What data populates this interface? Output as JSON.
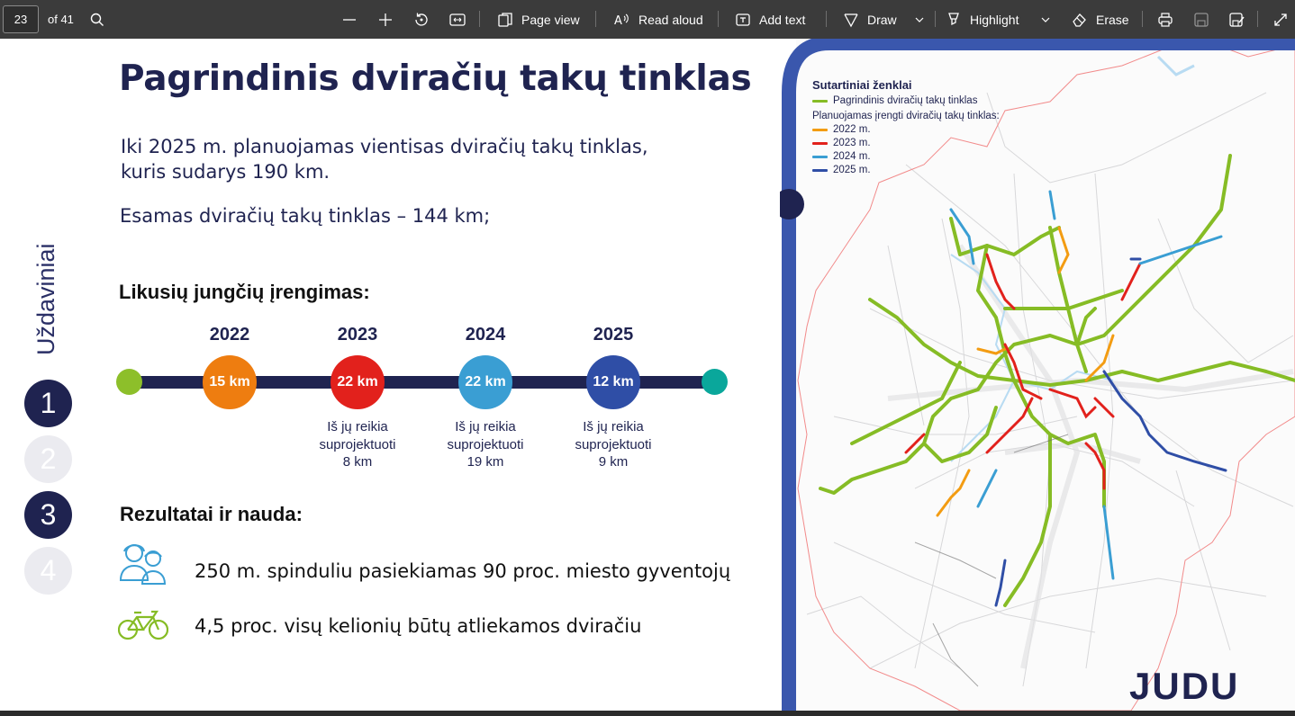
{
  "toolbar": {
    "page_number": "23",
    "page_total": "of 41",
    "page_view": "Page view",
    "read_aloud": "Read aloud",
    "add_text": "Add text",
    "draw": "Draw",
    "highlight": "Highlight",
    "erase": "Erase"
  },
  "slide": {
    "title": "Pagrindinis dviračių takų tinklas",
    "intro_line1": "Iki 2025 m. planuojamas vientisas dviračių takų tinklas,",
    "intro_line2": "kuris sudarys 190 km.",
    "existing": "Esamas dviračių takų tinklas – 144 km;",
    "section_label": "Uždaviniai",
    "steps": [
      "1",
      "2",
      "3",
      "4"
    ],
    "remaining_heading": "Likusių jungčių įrengimas:",
    "timeline": [
      {
        "year": "2022",
        "km": "15 km",
        "color": "#ee7d10",
        "note": []
      },
      {
        "year": "2023",
        "km": "22 km",
        "color": "#e2211c",
        "note": [
          "Iš jų reikia",
          "suprojektuoti",
          "8 km"
        ]
      },
      {
        "year": "2024",
        "km": "22 km",
        "color": "#3a9ed3",
        "note": [
          "Iš jų reikia",
          "suprojektuoti",
          "19 km"
        ]
      },
      {
        "year": "2025",
        "km": "12 km",
        "color": "#2f4ea6",
        "note": [
          "Iš jų reikia",
          "suprojektuoti",
          "9 km"
        ]
      }
    ],
    "timeline_start_color": "#8dbf2a",
    "timeline_end_color": "#0aa79b",
    "results_heading": "Rezultatai ir nauda:",
    "benefit1": "250 m. spinduliu pasiekiamas 90 proc. miesto gyventojų",
    "benefit2": "4,5 proc. visų kelionių būtų atliekamos dviračiu"
  },
  "legend": {
    "title": "Sutartiniai ženklai",
    "main": "Pagrindinis dviračių takų tinklas",
    "main_color": "#86bc25",
    "planned": "Planuojamas įrengti dviračių takų tinklas:",
    "items": [
      {
        "label": "2022 m.",
        "color": "#f39c12"
      },
      {
        "label": "2023 m.",
        "color": "#e2211c"
      },
      {
        "label": "2024 m.",
        "color": "#3a9ed3"
      },
      {
        "label": "2025 m.",
        "color": "#2f4ea6"
      }
    ]
  },
  "logo": "JUDU"
}
